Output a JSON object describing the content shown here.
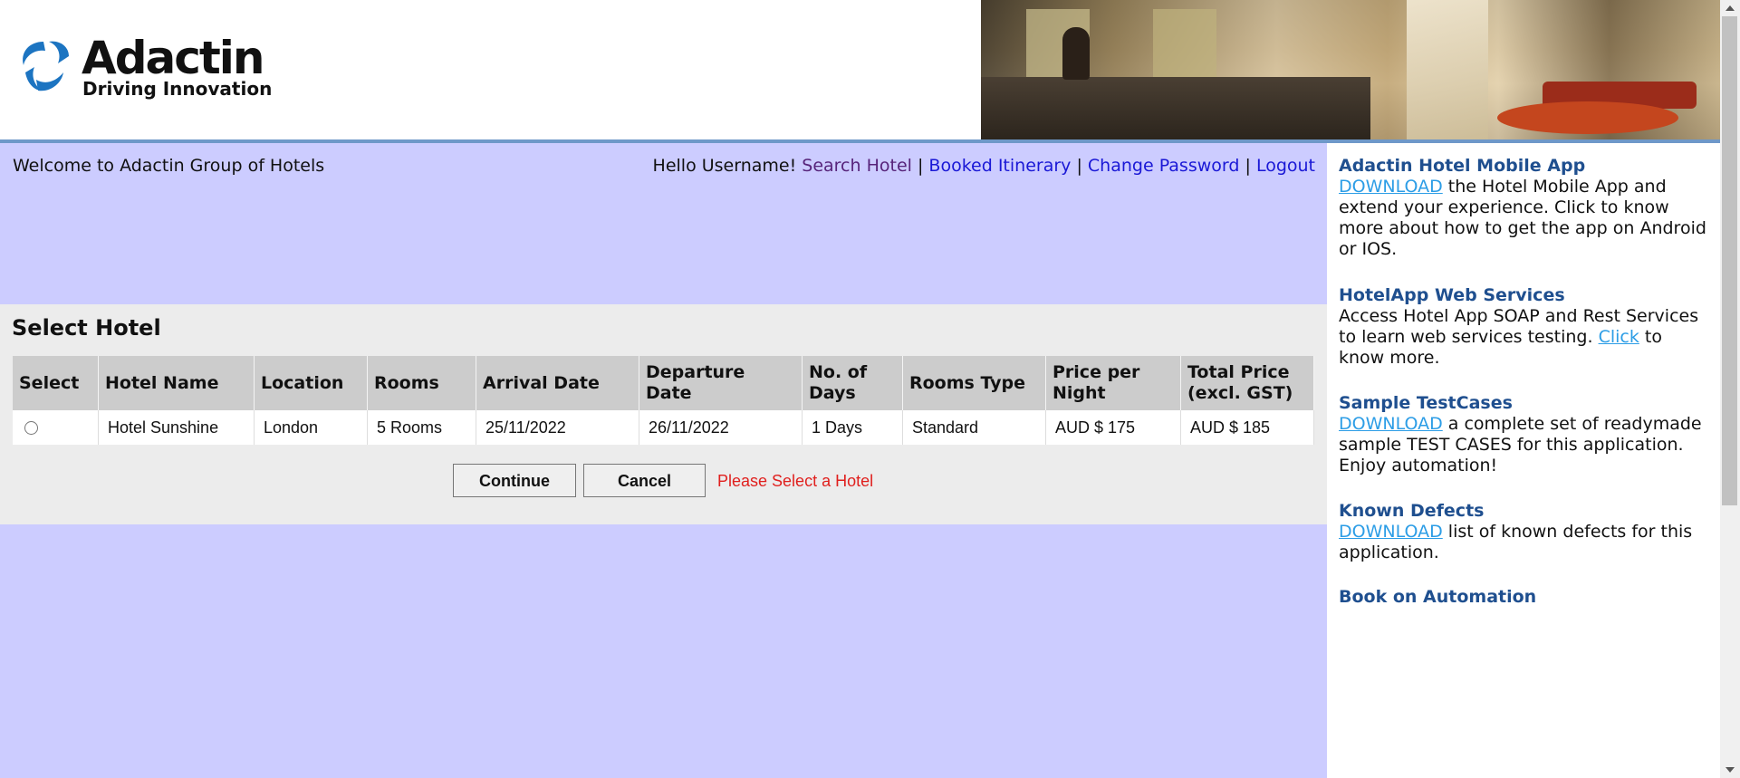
{
  "header": {
    "logo_title": "Adactin",
    "logo_subtitle": "Driving Innovation"
  },
  "topbar": {
    "welcome": "Welcome to Adactin Group of Hotels",
    "greeting": "Hello Username!",
    "nav": [
      {
        "label": "Search Hotel"
      },
      {
        "label": "Booked Itinerary"
      },
      {
        "label": "Change Password"
      },
      {
        "label": "Logout"
      }
    ],
    "separator": "|"
  },
  "select_hotel": {
    "title": "Select Hotel",
    "columns": [
      "Select",
      "Hotel Name",
      "Location",
      "Rooms",
      "Arrival Date",
      "Departure Date",
      "No. of Days",
      "Rooms Type",
      "Price per Night",
      "Total Price (excl. GST)"
    ],
    "rows": [
      {
        "hotel_name": "Hotel Sunshine",
        "location": "London",
        "rooms": "5 Rooms",
        "arrival_date": "25/11/2022",
        "departure_date": "26/11/2022",
        "days": "1 Days",
        "room_type": "Standard",
        "price_per_night": "AUD $ 175",
        "total_price": "AUD $ 185"
      }
    ],
    "continue_label": "Continue",
    "cancel_label": "Cancel",
    "error_message": "Please Select a Hotel"
  },
  "sidebar": {
    "mobile_app": {
      "title": "Adactin Hotel Mobile App",
      "link": "DOWNLOAD",
      "text": " the Hotel Mobile App and extend your experience. Click to know more about how to get the app on Android or IOS."
    },
    "web_services": {
      "title": "HotelApp Web Services",
      "text_before": "Access Hotel App SOAP and Rest Services to learn web services testing. ",
      "link": "Click",
      "text_after": " to know more."
    },
    "test_cases": {
      "title": "Sample TestCases",
      "link": "DOWNLOAD",
      "text": " a complete set of readymade sample TEST CASES for this application. Enjoy automation!"
    },
    "known_defects": {
      "title": "Known Defects",
      "link": "DOWNLOAD",
      "text": " list of known defects for this application."
    },
    "book": {
      "title": "Book on Automation"
    }
  },
  "colors": {
    "main_bg": "#ccccff",
    "panel_bg": "#ececec",
    "header_divider": "#6e98c9",
    "sidebar_title": "#1f4f8f",
    "sidebar_link": "#2c9de6",
    "nav_link": "#1a18d6",
    "nav_link_visited": "#57247a",
    "error": "#e0201e"
  }
}
